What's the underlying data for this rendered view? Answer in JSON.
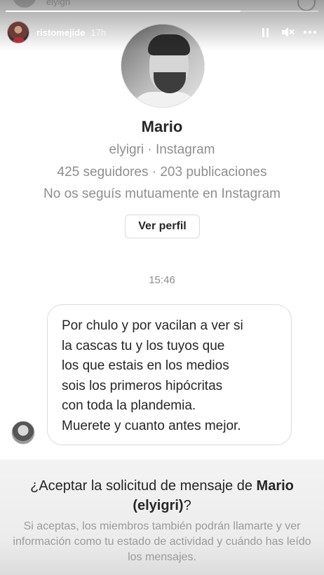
{
  "story": {
    "username": "ristomejide",
    "time_ago": "17h",
    "ghost_username": "elyigri",
    "progress_fraction": 0.75
  },
  "profile": {
    "name": "Mario",
    "handle_line": "elyigri · Instagram",
    "stats_line": "425 seguidores · 203 publicaciones",
    "mutual_line": "No os seguís mutuamente en Instagram",
    "view_profile_label": "Ver perfil"
  },
  "conversation": {
    "timestamp": "15:46",
    "message_lines": [
      "Por chulo y por vacilan a ver si",
      "la cascas tu y los tuyos que",
      "los que estais en los medios",
      "sois los primeros hipócritas",
      "con toda la plandemia.",
      "Muerete y cuanto antes mejor."
    ]
  },
  "request": {
    "title_prefix": "¿Aceptar la solicitud de mensaje de ",
    "title_name": "Mario",
    "title_handle": "(elyigri)",
    "title_suffix": "?",
    "note": "Si aceptas, los miembros también podrán llamarte y ver información como tu estado de actividad y cuándo has leído los mensajes."
  },
  "icons": {
    "pause": "pause-icon",
    "mute": "mute-icon",
    "more": "more-icon"
  },
  "colors": {
    "text_primary": "#262626",
    "text_secondary": "#8e8e8e",
    "border": "#dbdbdb"
  }
}
